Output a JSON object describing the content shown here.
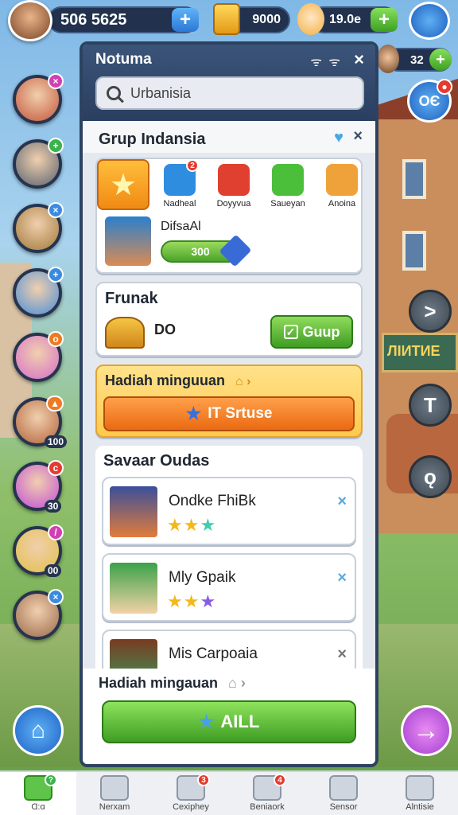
{
  "topbar": {
    "coins": "506 5625",
    "gold": "9000",
    "stars": "19.0e"
  },
  "mini_counter": "32",
  "chat_button": "ОЄ",
  "left_avatars": [
    {
      "badge": "×",
      "badge_color": "pink",
      "sub": ""
    },
    {
      "badge": "+",
      "badge_color": "green",
      "sub": ""
    },
    {
      "badge": "×",
      "badge_color": "blue",
      "sub": ""
    },
    {
      "badge": "+",
      "badge_color": "blue",
      "sub": ""
    },
    {
      "badge": "o",
      "badge_color": "orange",
      "sub": ""
    },
    {
      "badge": "▲",
      "badge_color": "orange",
      "sub": "100"
    },
    {
      "badge": "c",
      "badge_color": "red",
      "sub": "30"
    },
    {
      "badge": "/",
      "badge_color": "pink",
      "sub": "00"
    },
    {
      "badge": "×",
      "badge_color": "blue",
      "sub": ""
    }
  ],
  "right_buttons": [
    ">",
    "T",
    "ǫ"
  ],
  "panel": {
    "title": "Notuma",
    "search_placeholder": "Urbanisia",
    "group_title": "Grup Indansia",
    "group_tabs": [
      {
        "label": "Nadheal",
        "color": "#2f8de0",
        "badge": "2"
      },
      {
        "label": "Doyyvua",
        "color": "#e0402f",
        "badge": ""
      },
      {
        "label": "Saueyan",
        "color": "#4cbf3a",
        "badge": ""
      },
      {
        "label": "Anoina",
        "color": "#f0a23a",
        "badge": ""
      }
    ],
    "member_name": "DifsaAl",
    "member_value": "300",
    "frunak": {
      "title": "Frunak",
      "value": "DO",
      "button": "Guup"
    },
    "weekly": {
      "title": "Hadiah minguuan",
      "button": "IT Srtuse"
    },
    "savaar_title": "Savaar Oudas",
    "players": [
      {
        "name": "Ondke FhiBk",
        "stars": [
          "gold",
          "gold",
          "teal"
        ],
        "av_colors": [
          "#3a4f9b",
          "#e27c3b"
        ]
      },
      {
        "name": "Mly Gpaik",
        "stars": [
          "gold",
          "gold",
          "purple"
        ],
        "av_colors": [
          "#3ba24a",
          "#f2d2a6"
        ]
      },
      {
        "name": "Mis Carpoaia",
        "stars": [
          "gold",
          "pink"
        ],
        "av_colors": [
          "#7a3b22",
          "#3a9a5a"
        ]
      }
    ],
    "bottom": {
      "title": "Hadiah mingauan",
      "button": "AILL"
    }
  },
  "navbar": [
    {
      "label": "Ɑ:ɑ",
      "badge": "?",
      "active": true
    },
    {
      "label": "Nerxam",
      "badge": "",
      "active": false
    },
    {
      "label": "Cexiphey",
      "badge": "3",
      "active": false
    },
    {
      "label": "Beniaork",
      "badge": "4",
      "active": false
    },
    {
      "label": "Sensor",
      "badge": "",
      "active": false
    },
    {
      "label": "Alntisie",
      "badge": "",
      "active": false
    }
  ],
  "colors": {
    "panel_header": "#2d4261",
    "accent_green": "#4aa52b",
    "accent_orange": "#ea6a12"
  }
}
